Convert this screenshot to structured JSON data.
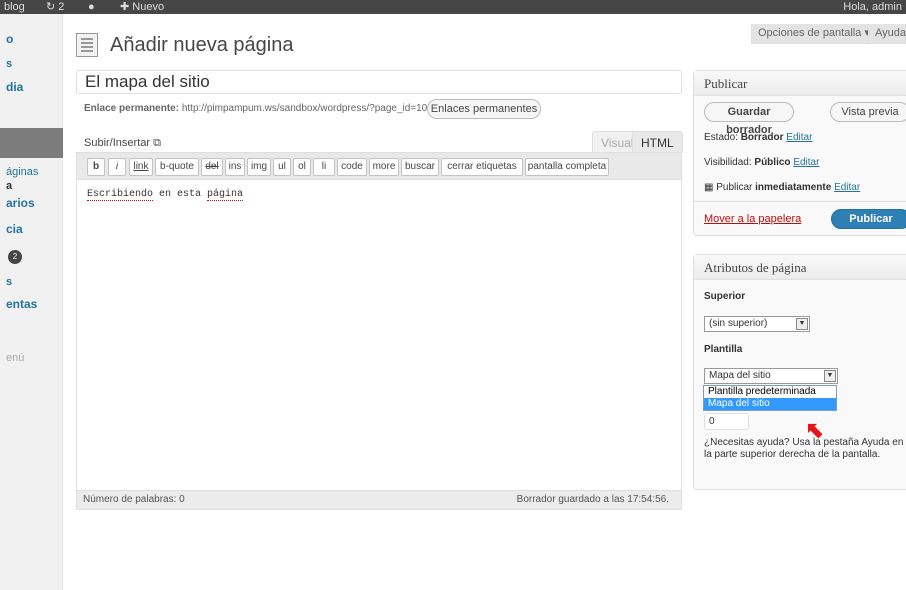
{
  "adminbar": {
    "site": "blog",
    "updates": "2",
    "new_label": "Nuevo",
    "greeting": "Hola, admin"
  },
  "sidebar": {
    "items": [
      {
        "label": "o"
      },
      {
        "label": "s"
      },
      {
        "label": "dia"
      },
      {
        "label": "áginas"
      },
      {
        "label": "a"
      },
      {
        "label": "arios"
      },
      {
        "label": "cia"
      },
      {
        "label": "s"
      },
      {
        "label": "entas"
      }
    ],
    "badge": "2",
    "collapse": "enú"
  },
  "header": {
    "screen_options": "Opciones de pantalla ▾",
    "help": "Ayuda"
  },
  "page": {
    "title": "Añadir nueva página",
    "post_title": "El mapa del sitio",
    "permalink_label": "Enlace permanente:",
    "permalink_url": "http://pimpampum.ws/sandbox/wordpress/?page_id=10",
    "permalink_button": "Enlaces permanentes"
  },
  "editor": {
    "upload_label": "Subir/Insertar",
    "tab_visual": "Visual",
    "tab_html": "HTML",
    "buttons": [
      "b",
      "i",
      "link",
      "b-quote",
      "del",
      "ins",
      "img",
      "ul",
      "ol",
      "li",
      "code",
      "more",
      "buscar",
      "cerrar etiquetas",
      "pantalla completa"
    ],
    "content_word1": "Escribiendo",
    "content_mid": " en esta ",
    "content_word2": "página",
    "word_count": "Número de palabras: 0",
    "draft_saved": "Borrador guardado a las 17:54:56."
  },
  "publish": {
    "title": "Publicar",
    "save_draft": "Guardar borrador",
    "preview": "Vista previa",
    "status_label": "Estado:",
    "status_value": "Borrador",
    "visibility_label": "Visibilidad:",
    "visibility_value": "Público",
    "publish_label": "Publicar",
    "publish_value": "inmediatamente",
    "edit": "Editar",
    "trash": "Mover a la papelera",
    "publish_button": "Publicar"
  },
  "attributes": {
    "title": "Atributos de página",
    "parent_label": "Superior",
    "parent_value": "(sin superior)",
    "template_label": "Plantilla",
    "template_value": "Mapa del sitio",
    "template_options": [
      "Plantilla predeterminada",
      "Mapa del sitio"
    ],
    "order_value": "0",
    "help_text": "¿Necesitas ayuda? Usa la pestaña Ayuda en la parte superior derecha de la pantalla."
  },
  "colors": {
    "accent": "#21759b",
    "publish": "#2e7fb3",
    "trash": "#bc0b0b",
    "highlight": "#3399ff",
    "arrow": "#e8141a"
  }
}
